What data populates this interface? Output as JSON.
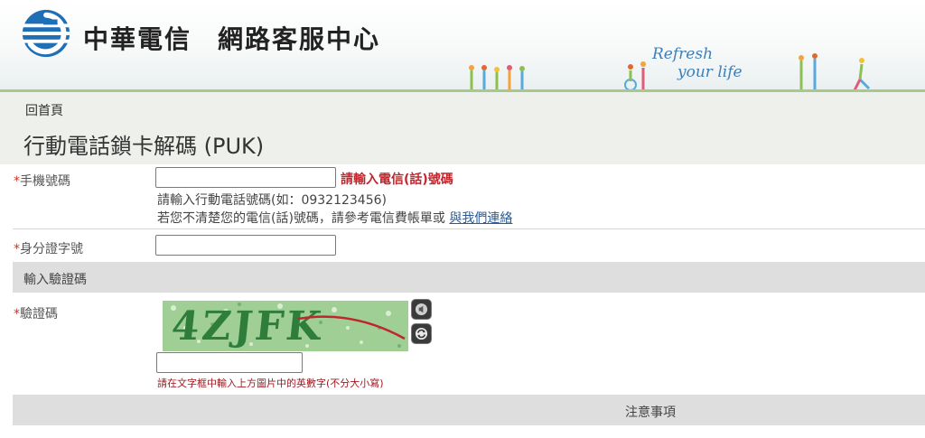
{
  "header": {
    "company": "中華電信",
    "center": "網路客服中心",
    "tagline_line1": "Refresh",
    "tagline_line2": "your life"
  },
  "breadcrumb": {
    "home": "回首頁"
  },
  "page_title": "行動電話鎖卡解碼 (PUK)",
  "form": {
    "mobile": {
      "required_mark": "*",
      "label": "手機號碼",
      "value": "",
      "error": "請輸入電信(話)號碼",
      "hint1": "請輸入行動電話號碼(如：0932123456)",
      "hint2_prefix": "若您不清楚您的電信(話)號碼，請參考電信費帳單或",
      "hint2_link": "與我們連絡"
    },
    "id": {
      "required_mark": "*",
      "label": "身分證字號",
      "value": ""
    },
    "captcha_section": "輸入驗證碼",
    "captcha": {
      "required_mark": "*",
      "label": "驗證碼",
      "image_text": "4ZJFK",
      "value": "",
      "hint": "請在文字框中輸入上方圖片中的英數字(不分大小寫)"
    }
  },
  "notes_section": "注意事項",
  "colors": {
    "brand_blue": "#1f6fb6",
    "error_red": "#c0262d",
    "link_blue": "#2a5c99",
    "tagline_blue": "#3d7fb8"
  },
  "icons": [
    "chunghwa-logo",
    "audio-icon",
    "refresh-icon"
  ]
}
